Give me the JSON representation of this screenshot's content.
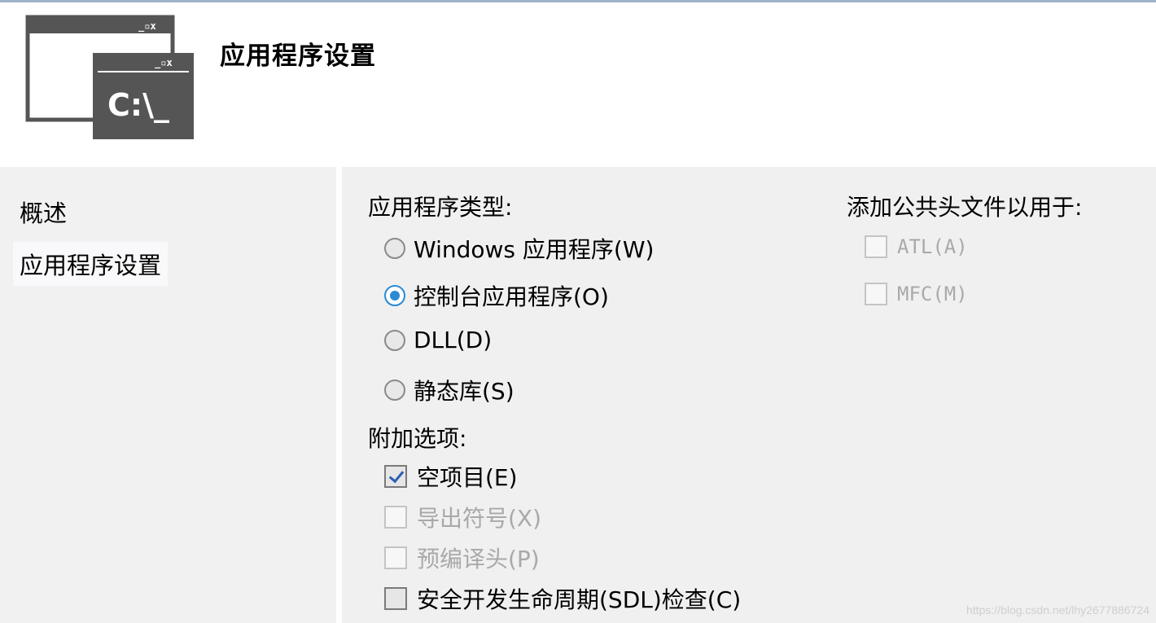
{
  "header": {
    "title": "应用程序设置",
    "icon_text": "C:\\_",
    "icon_window_controls": "_ ▫ x"
  },
  "sidebar": {
    "items": [
      {
        "label": "概述"
      },
      {
        "label": "应用程序设置",
        "selected": true
      }
    ]
  },
  "app_type": {
    "label": "应用程序类型:",
    "options": [
      {
        "label": "Windows 应用程序(W)",
        "checked": false
      },
      {
        "label": "控制台应用程序(O)",
        "checked": true
      },
      {
        "label": "DLL(D)",
        "checked": false
      },
      {
        "label": "静态库(S)",
        "checked": false
      }
    ]
  },
  "additional": {
    "label": "附加选项:",
    "options": [
      {
        "label": "空项目(E)",
        "checked": true,
        "enabled": true
      },
      {
        "label": "导出符号(X)",
        "checked": false,
        "enabled": false
      },
      {
        "label": "预编译头(P)",
        "checked": false,
        "enabled": false
      },
      {
        "label": "安全开发生命周期(SDL)检查(C)",
        "checked": false,
        "enabled": true
      }
    ]
  },
  "common_headers": {
    "label": "添加公共头文件以用于:",
    "options": [
      {
        "label": "ATL(A)",
        "checked": false,
        "enabled": false
      },
      {
        "label": "MFC(M)",
        "checked": false,
        "enabled": false
      }
    ]
  },
  "watermark": "https://blog.csdn.net/lhy2677886724",
  "colors": {
    "accent": "#2a8ad4",
    "panel_bg": "#f0f0f0",
    "disabled_text": "#a9a9a9"
  }
}
